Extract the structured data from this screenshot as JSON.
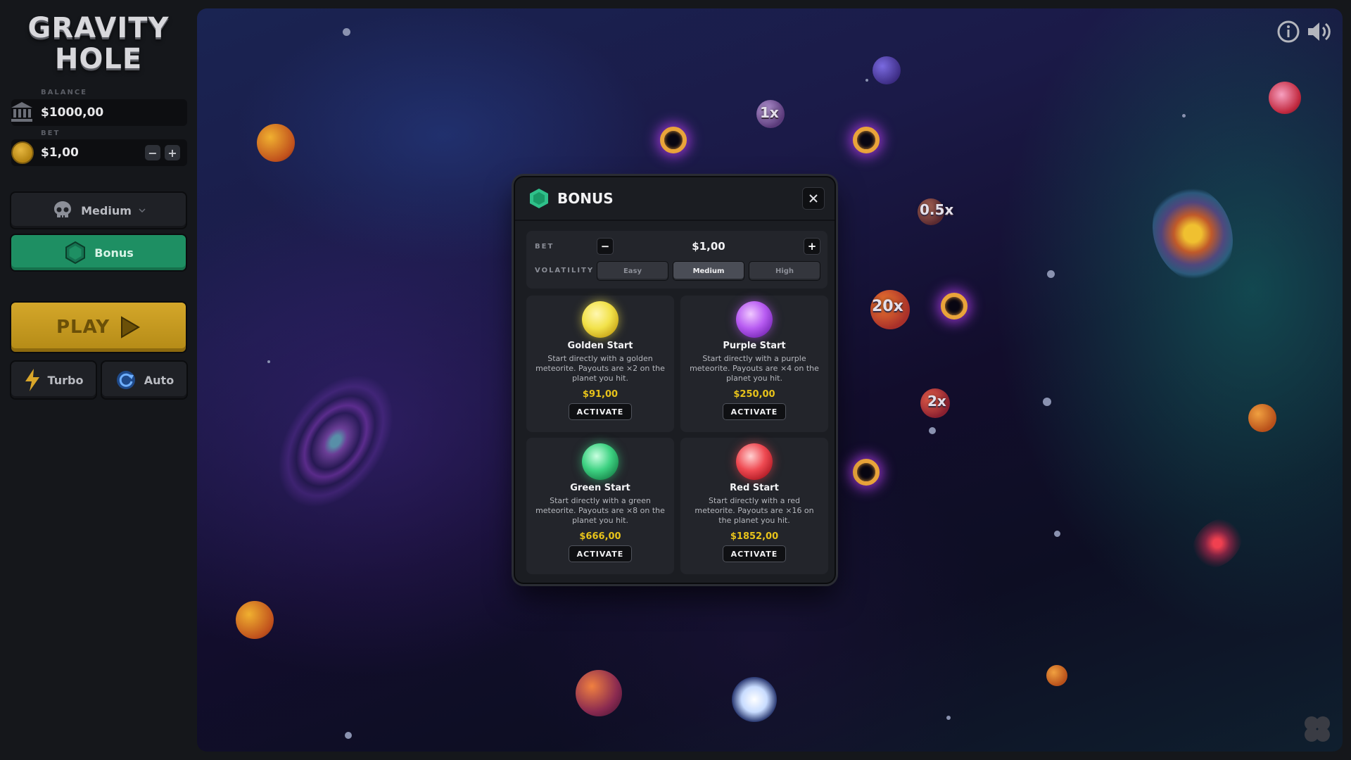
{
  "app": {
    "title_line1": "GRAVITY",
    "title_line2": "HOLE"
  },
  "sidebar": {
    "balance_label": "BALANCE",
    "balance_value": "$1000,00",
    "bet_label": "BET",
    "bet_value": "$1,00",
    "minus": "−",
    "plus": "+",
    "volatility_label": "Medium",
    "bonus_label": "Bonus",
    "play_label": "PLAY",
    "turbo_label": "Turbo",
    "auto_label": "Auto"
  },
  "board": {
    "multipliers": [
      "1x",
      "0.5x",
      "20x",
      "2x"
    ]
  },
  "modal": {
    "title": "BONUS",
    "bet_label": "BET",
    "bet_value": "$1,00",
    "volatility_label": "VOLATILITY",
    "volatility_options": [
      "Easy",
      "Medium",
      "High"
    ],
    "volatility_selected": "Medium",
    "cards": [
      {
        "title": "Golden Start",
        "desc": "Start directly with a golden meteorite. Payouts are ×2 on the planet you hit.",
        "price": "$91,00",
        "action": "ACTIVATE",
        "color": "#f2e24a"
      },
      {
        "title": "Purple Start",
        "desc": "Start directly with a purple meteorite. Payouts are ×4 on the planet you hit.",
        "price": "$250,00",
        "action": "ACTIVATE",
        "color": "#b85cf2"
      },
      {
        "title": "Green Start",
        "desc": "Start directly with a green meteorite. Payouts are ×8 on the planet you hit.",
        "price": "$666,00",
        "action": "ACTIVATE",
        "color": "#3ed282"
      },
      {
        "title": "Red Start",
        "desc": "Start directly with a red meteorite. Payouts are ×16 on the planet you hit.",
        "price": "$1852,00",
        "action": "ACTIVATE",
        "color": "#ef4a52"
      }
    ]
  },
  "colors": {
    "accent_green": "#1e8f63",
    "play_gold": "#c99b1f",
    "price_gold": "#e8c31a"
  }
}
